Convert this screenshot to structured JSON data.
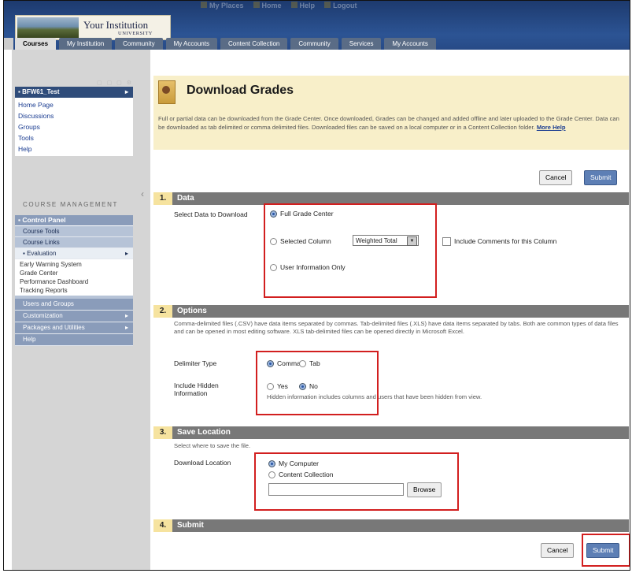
{
  "header": {
    "institution": "Your Institution",
    "university": "UNIVERSITY",
    "top_links": [
      "My Places",
      "Home",
      "Help",
      "Logout"
    ],
    "tabs": [
      "Courses",
      "My Institution",
      "Community",
      "My Accounts",
      "Content Collection",
      "Community",
      "Services",
      "My Accounts"
    ]
  },
  "sidebar": {
    "course_title": "BFW61_Test",
    "course_links": [
      "Home Page",
      "Discussions",
      "Groups",
      "Tools",
      "Help"
    ],
    "course_management_label": "COURSE MANAGEMENT",
    "control_panel_label": "Control Panel",
    "control_items": [
      "Course Tools",
      "Course Links"
    ],
    "evaluation_label": "Evaluation",
    "evaluation_sub": [
      "Early Warning System",
      "Grade Center",
      "Performance Dashboard",
      "Tracking Reports"
    ],
    "other_items": [
      "Users and Groups",
      "Customization",
      "Packages and Utilities",
      "Help"
    ]
  },
  "page": {
    "title": "Download Grades",
    "intro": "Full or partial data can be downloaded from the Grade Center. Once downloaded, Grades can be changed and added offline and later uploaded to the Grade Center. Data can be downloaded as tab delimited or comma delimited files. Downloaded files can be saved on a local computer or in a Content Collection folder.",
    "more_help": "More Help",
    "cancel": "Cancel",
    "submit": "Submit"
  },
  "data_section": {
    "num": "1.",
    "title": "Data",
    "select_label": "Select Data to Download",
    "full": "Full Grade Center",
    "selected_column": "Selected Column",
    "column_value": "Weighted Total",
    "include_comments": "Include Comments for this Column",
    "user_info": "User Information Only"
  },
  "options_section": {
    "num": "2.",
    "title": "Options",
    "desc": "Comma-delimited files (.CSV) have data items separated by commas. Tab-delimited files (.XLS) have data items separated by tabs. Both are common types of data files and can be opened in most editing software. XLS tab-delimited files can be opened directly in Microsoft Excel.",
    "delimiter_label": "Delimiter Type",
    "comma": "Comma",
    "tab": "Tab",
    "hidden_label_1": "Include Hidden",
    "hidden_label_2": "Information",
    "yes": "Yes",
    "no": "No",
    "hidden_desc": "Hidden information includes columns and users that have been hidden from view."
  },
  "save_section": {
    "num": "3.",
    "title": "Save Location",
    "desc": "Select where to save the file.",
    "location_label": "Download Location",
    "my_computer": "My Computer",
    "content_collection": "Content Collection",
    "browse": "Browse"
  },
  "submit_section": {
    "num": "4.",
    "title": "Submit"
  },
  "colors": {
    "highlight": "#d21f1f",
    "section_bar": "#787878",
    "info_bg": "#f8efc9",
    "header_blue": "#2c5494"
  }
}
